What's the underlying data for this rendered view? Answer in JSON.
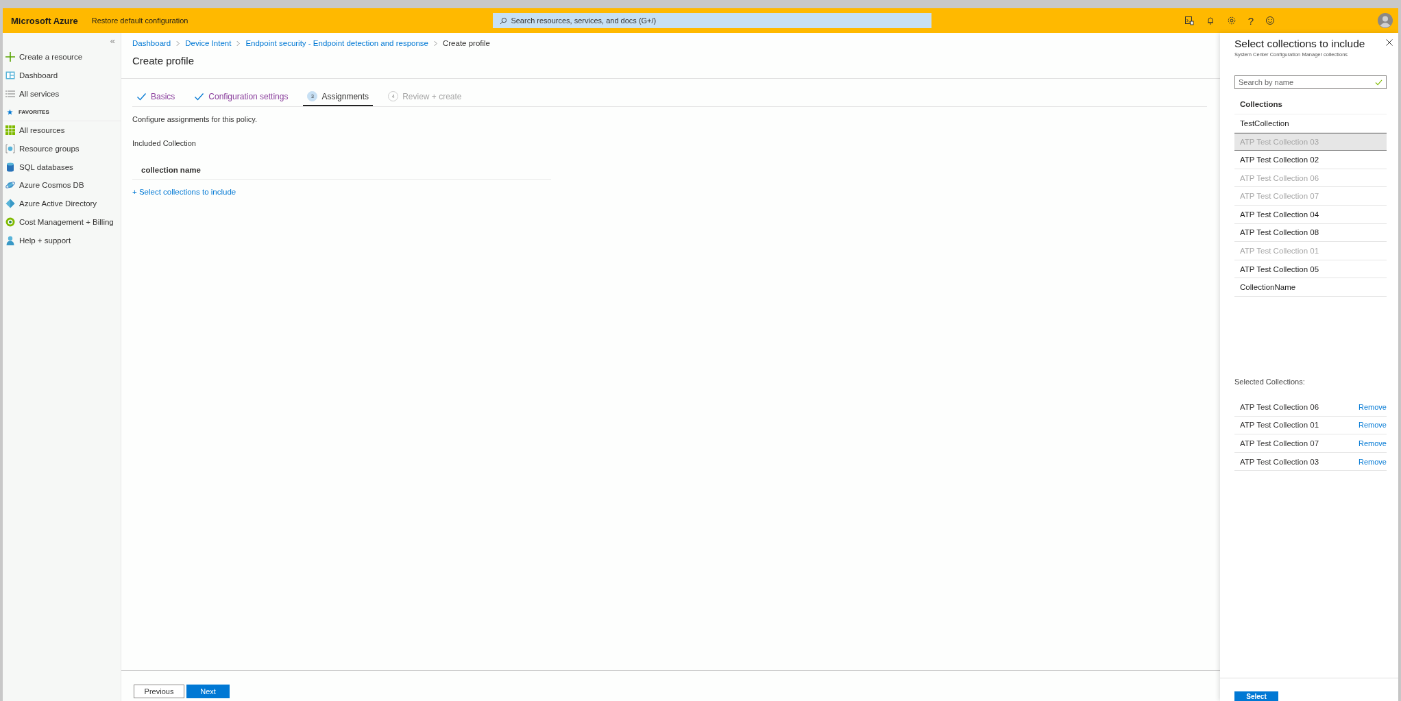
{
  "header": {
    "brand": "Microsoft Azure",
    "link": "Restore default configuration",
    "search_placeholder": "Search resources, services, and docs (G+/)",
    "help": "?"
  },
  "sidebar": {
    "collapse": "«",
    "items": [
      {
        "kind": "plus",
        "label": "Create a resource"
      },
      {
        "kind": "dashboard",
        "label": "Dashboard"
      },
      {
        "kind": "list",
        "label": "All services"
      },
      {
        "kind": "section",
        "label": "FAVORITES"
      },
      {
        "kind": "grid",
        "label": "All resources"
      },
      {
        "kind": "cube",
        "label": "Resource groups"
      },
      {
        "kind": "db",
        "label": "SQL databases"
      },
      {
        "kind": "planet",
        "label": "Azure Cosmos DB"
      },
      {
        "kind": "diamond",
        "label": "Azure Active Directory"
      },
      {
        "kind": "ring",
        "label": "Cost Management + Billing"
      },
      {
        "kind": "person",
        "label": "Help + support"
      }
    ]
  },
  "breadcrumb": [
    {
      "label": "Dashboard",
      "link": true
    },
    {
      "label": "Device Intent",
      "link": true
    },
    {
      "label": "Endpoint security - Endpoint detection and response",
      "link": true
    },
    {
      "label": "Create profile",
      "link": false
    }
  ],
  "page_title": "Create profile",
  "steps": [
    {
      "label": "Basics",
      "kind": "done",
      "selected": false
    },
    {
      "label": "Configuration settings",
      "kind": "done",
      "selected": false
    },
    {
      "label": "Assignments",
      "kind": "current",
      "number": "3",
      "selected": true
    },
    {
      "label": "Review + create",
      "kind": "todo",
      "number": "4",
      "selected": false
    }
  ],
  "intro": "Configure assignments for this policy.",
  "included_label": "Included Collection",
  "table": {
    "columns": [
      "collection name"
    ]
  },
  "add_link": "+ Select collections to include",
  "footer": {
    "previous": "Previous",
    "next": "Next"
  },
  "panel": {
    "title": "Select collections to include",
    "subtitle": "System Center Configuration Manager collections",
    "search_placeholder": "Search by name",
    "list_header": "Collections",
    "items": [
      {
        "name": "TestCollection",
        "selected": false,
        "disabled": false
      },
      {
        "name": "ATP Test Collection 03",
        "selected": true,
        "disabled": true
      },
      {
        "name": "ATP Test Collection 02",
        "selected": false,
        "disabled": false
      },
      {
        "name": "ATP Test Collection 06",
        "selected": false,
        "disabled": true
      },
      {
        "name": "ATP Test Collection 07",
        "selected": false,
        "disabled": true
      },
      {
        "name": "ATP Test Collection 04",
        "selected": false,
        "disabled": false
      },
      {
        "name": "ATP Test Collection 08",
        "selected": false,
        "disabled": false
      },
      {
        "name": "ATP Test Collection 01",
        "selected": false,
        "disabled": true
      },
      {
        "name": "ATP Test Collection 05",
        "selected": false,
        "disabled": false
      },
      {
        "name": "CollectionName",
        "selected": false,
        "disabled": false
      }
    ],
    "selected_label": "Selected Collections:",
    "selected_items": [
      {
        "name": "ATP Test Collection 06",
        "action": "Remove"
      },
      {
        "name": "ATP Test Collection 01",
        "action": "Remove"
      },
      {
        "name": "ATP Test Collection 07",
        "action": "Remove"
      },
      {
        "name": "ATP Test Collection 03",
        "action": "Remove"
      }
    ],
    "select_button": "Select"
  }
}
